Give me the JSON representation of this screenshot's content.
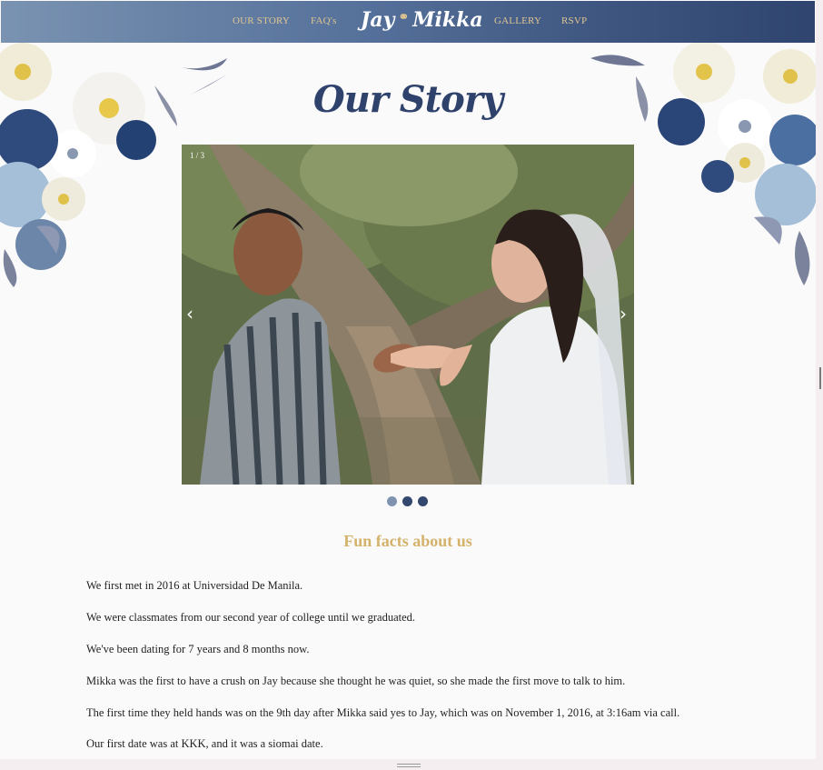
{
  "nav": {
    "links": [
      "OUR STORY",
      "FAQ's",
      "GALLERY",
      "RSVP"
    ],
    "brand_left": "Jay",
    "brand_right": "Mikka",
    "brand_icon": "rings-icon"
  },
  "page_title": "Our Story",
  "carousel": {
    "counter": "1 / 3",
    "prev_icon": "chevron-left-icon",
    "next_icon": "chevron-right-icon",
    "slide_count": 3,
    "active_index": 0
  },
  "fun_facts": {
    "title": "Fun facts about us",
    "items": [
      "We first met in 2016 at Universidad De Manila.",
      "We were classmates from our second year of college until we graduated.",
      "We've been dating for 7 years and 8 months now.",
      "Mikka was the first to have a crush on Jay because she thought he was quiet, so she made the first move to talk to him.",
      "The first time they held hands was on the 9th day after Mikka said yes to Jay, which was on November 1, 2016, at 3:16am via call.",
      "Our first date was at KKK, and it was a siomai date."
    ]
  },
  "colors": {
    "accent_gold": "#d4b26a",
    "navy": "#2e426b",
    "nav_start": "#7a93b2",
    "nav_end": "#2f4570"
  }
}
